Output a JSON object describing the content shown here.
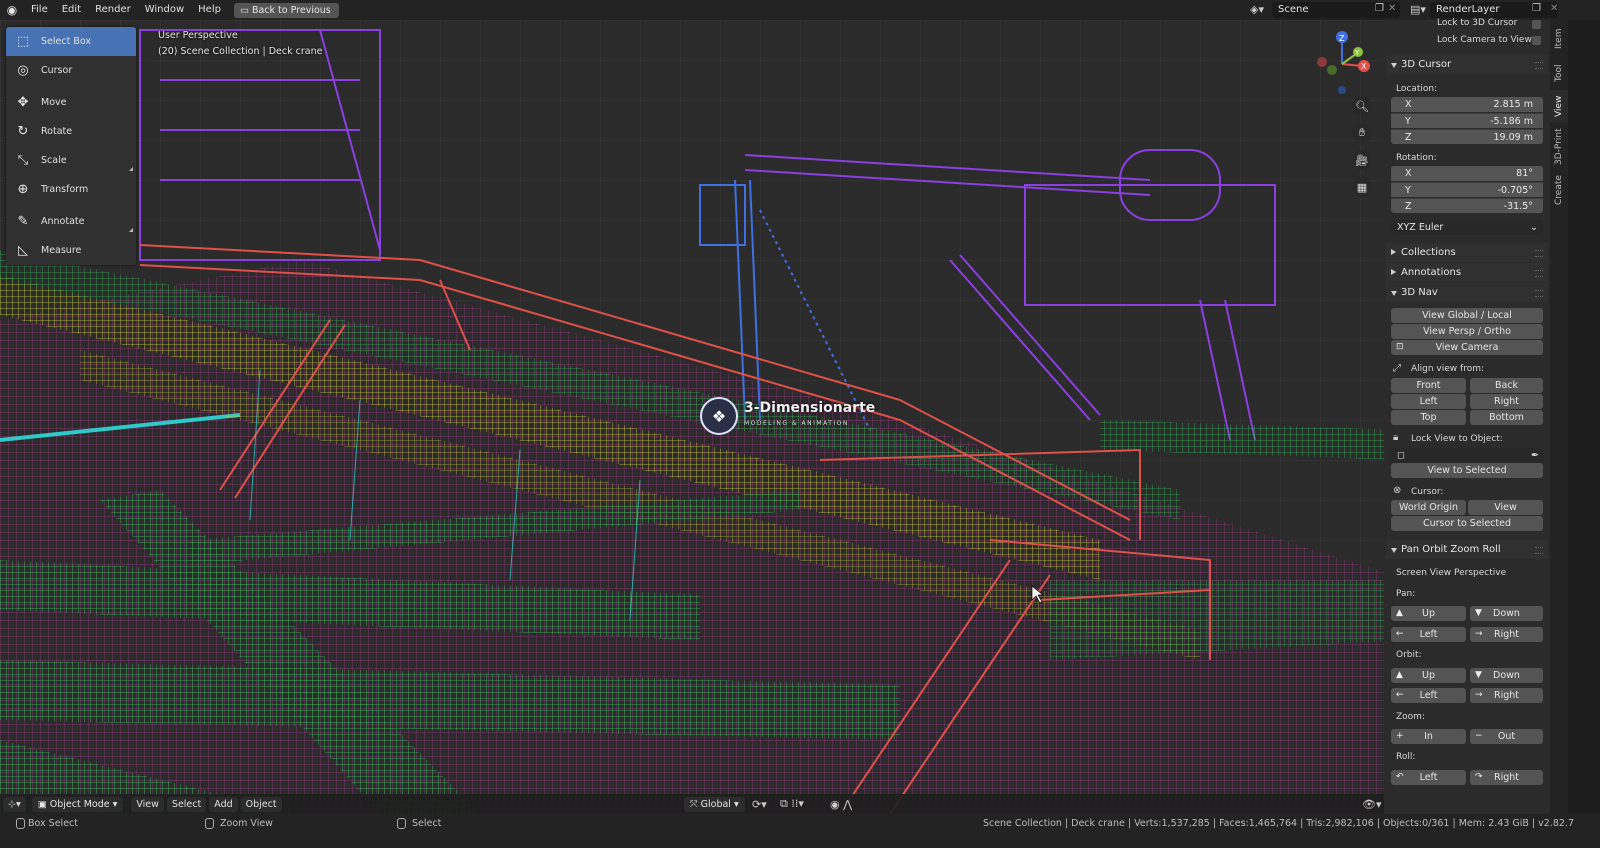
{
  "topbar": {
    "menus": [
      "File",
      "Edit",
      "Render",
      "Window",
      "Help"
    ],
    "back_button": "Back to Previous",
    "scene": "Scene",
    "view_layer": "RenderLayer"
  },
  "toolbar": {
    "tools": [
      {
        "label": "Select Box",
        "icon": "select-box-icon",
        "glyph": "⬚",
        "active": true
      },
      {
        "label": "Cursor",
        "icon": "cursor-icon",
        "glyph": "◎"
      },
      {
        "label": "Move",
        "icon": "move-icon",
        "glyph": "✥"
      },
      {
        "label": "Rotate",
        "icon": "rotate-icon",
        "glyph": "↻"
      },
      {
        "label": "Scale",
        "icon": "scale-icon",
        "glyph": "⤡"
      },
      {
        "label": "Transform",
        "icon": "transform-icon",
        "glyph": "⊕"
      },
      {
        "label": "Annotate",
        "icon": "annotate-icon",
        "glyph": "✎"
      },
      {
        "label": "Measure",
        "icon": "measure-icon",
        "glyph": "📐"
      }
    ]
  },
  "viewport": {
    "perspective": "User Perspective",
    "collection": "(20) Scene Collection | Deck crane",
    "watermark_title": "3-Dimensionarte",
    "watermark_sub": "MODELING & ANIMATION",
    "axes": {
      "x": "X",
      "y": "Y",
      "z": "Z"
    }
  },
  "header": {
    "mode": "Object Mode",
    "menus": [
      "View",
      "Select",
      "Add",
      "Object"
    ],
    "orientation": "Global"
  },
  "sidebar": {
    "tabs": [
      "Item",
      "Tool",
      "View",
      "3D-Print",
      "Create"
    ],
    "active_tab": "View",
    "lock_to_cursor": "Lock to 3D Cursor",
    "lock_camera": "Lock Camera to View",
    "cursor_panel": "3D Cursor",
    "location_label": "Location:",
    "location": [
      {
        "axis": "X",
        "value": "2.815 m"
      },
      {
        "axis": "Y",
        "value": "-5.186 m"
      },
      {
        "axis": "Z",
        "value": "19.09 m"
      }
    ],
    "rotation_label": "Rotation:",
    "rotation": [
      {
        "axis": "X",
        "value": "81°"
      },
      {
        "axis": "Y",
        "value": "-0.705°"
      },
      {
        "axis": "Z",
        "value": "-31.5°"
      }
    ],
    "rotation_mode": "XYZ Euler",
    "collections": "Collections",
    "annotations": "Annotations",
    "nav_panel": "3D Nav",
    "view_global_local": "View Global / Local",
    "view_persp_ortho": "View Persp / Ortho",
    "view_camera": "View Camera",
    "align_view_from": "Align view from:",
    "align": {
      "front": "Front",
      "back": "Back",
      "left": "Left",
      "right": "Right",
      "top": "Top",
      "bottom": "Bottom"
    },
    "lock_view_to_object": "Lock View to Object:",
    "view_to_selected": "View to Selected",
    "cursor_label": "Cursor:",
    "world_origin": "World Origin",
    "cursor_view": "View",
    "cursor_to_selected": "Cursor to Selected",
    "pan_panel": "Pan Orbit Zoom Roll",
    "screen_view": "Screen View Perspective",
    "pan": "Pan:",
    "orbit": "Orbit:",
    "zoom": "Zoom:",
    "roll": "Roll:",
    "up": "Up",
    "down": "Down",
    "left": "Left",
    "right": "Right",
    "in": "In",
    "out": "Out"
  },
  "status": {
    "left_action": "Box Select",
    "middle_action": "Zoom View",
    "right_action": "Select",
    "stats": "Scene Collection | Deck crane | Verts:1,537,285 | Faces:1,465,764 | Tris:2,982,106 | Objects:0/361 | Mem: 2.43 GiB | v2.82.7"
  },
  "colors": {
    "accent": "#4772b3",
    "wire_purple": "#8a3fe0",
    "wire_green": "#36c25c",
    "wire_yellow": "#c8d13a",
    "wire_red": "#e0504a",
    "wire_blue": "#3f6fe0",
    "wire_magenta": "#b43a9c"
  }
}
